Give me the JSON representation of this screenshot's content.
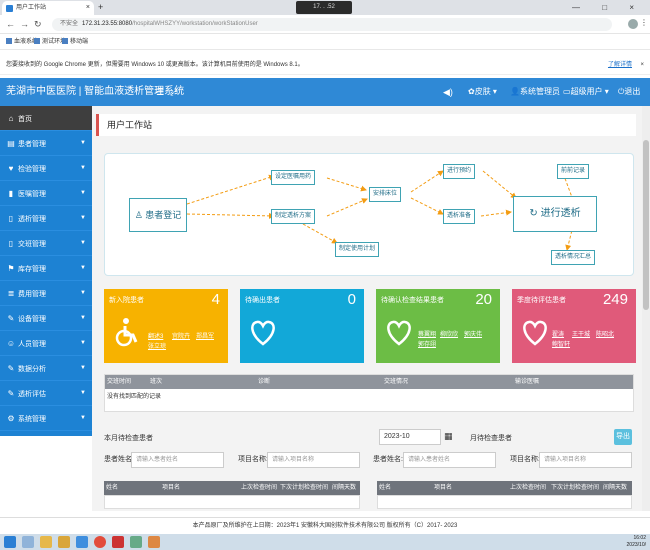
{
  "browser": {
    "tab_title": "用户工作站",
    "tab_close": "×",
    "new_tab": "+",
    "remote_label": "17.  .  .52",
    "window_controls": "—  □  ×",
    "insecure_label": "不安全",
    "url_host": "172.31.23.55:8080",
    "url_path": "/hospitalWHSZYY/workstation/workStationUser",
    "bookmarks": [
      "血液系统",
      "测试环境",
      "移动端"
    ],
    "info_message": "您要接收到的 Google Chrome 更新，但需要用 Windows 10 或更高版本。该计算机目前使用的是 Windows 8.1。",
    "info_more": "了解详情",
    "info_close": "×"
  },
  "header": {
    "system_name": "芜湖市中医医院 | 智能血液透析管理系统",
    "skin_label": "皮肤",
    "user_label": "系统管理员",
    "role_label": "超级用户",
    "logout_label": "退出"
  },
  "sidebar": {
    "items": [
      {
        "label": "首页",
        "icon": "home-icon"
      },
      {
        "label": "患者管理",
        "icon": "id-card-icon"
      },
      {
        "label": "检验管理",
        "icon": "heart-icon"
      },
      {
        "label": "医嘱管理",
        "icon": "bookmark-icon"
      },
      {
        "label": "透析管理",
        "icon": "document-icon"
      },
      {
        "label": "交班管理",
        "icon": "document-icon"
      },
      {
        "label": "库存管理",
        "icon": "flag-icon"
      },
      {
        "label": "费用管理",
        "icon": "database-icon"
      },
      {
        "label": "设备管理",
        "icon": "wrench-icon"
      },
      {
        "label": "人员管理",
        "icon": "users-icon"
      },
      {
        "label": "数据分析",
        "icon": "wrench-icon"
      },
      {
        "label": "透析评估",
        "icon": "wrench-icon"
      },
      {
        "label": "系统管理",
        "icon": "gear-icon"
      }
    ]
  },
  "page": {
    "title": "用户工作站"
  },
  "flow": {
    "patient_register": "患者登记",
    "set_orders": "设定医嘱用药",
    "make_plan": "制定透析方案",
    "make_usage": "制定使用计划",
    "schedule": "安排床位",
    "appointment": "进行预约",
    "prepare": "透析准备",
    "do_dialysis": "进行透析",
    "pre_record": "前前记录",
    "summary": "透析情况汇总"
  },
  "cards": [
    {
      "title": "新入院患者",
      "count": "4",
      "color": "#f7b200",
      "icon": "wheelchair-icon",
      "links": [
        "翻述3",
        "宫院卉",
        "郑昌军",
        "张立琼"
      ]
    },
    {
      "title": "待确出患者",
      "count": "0",
      "color": "#12a8d8",
      "icon": "heart-outline-icon",
      "links": []
    },
    {
      "title": "待确认检查结果患者",
      "count": "20",
      "color": "#6cbd45",
      "icon": "heart-outline-icon",
      "links": [
        "蔡翼翔",
        "柳欣欣",
        "郭庆伟",
        "郭存翊"
      ]
    },
    {
      "title": "季度待评估患者",
      "count": "249",
      "color": "#e05a7a",
      "icon": "heart-outline-icon",
      "links": [
        "翟涛",
        "王干城",
        "陈昭北",
        "鲍智轩"
      ]
    }
  ],
  "table": {
    "headers": [
      "交班时间",
      "班次",
      "诊断",
      "交班情况",
      "输诊医嘱"
    ],
    "empty_text": "没有找到匹配的记录"
  },
  "monthly": {
    "left_title": "本月待检查患者",
    "month_value": "2023-10",
    "right_title": "月待检查患者",
    "export_label": "导出",
    "patient_label": "患者姓名:",
    "patient_placeholder": "请输入患者姓名",
    "item_label": "项目名称:",
    "item_placeholder": "请输入项目名称",
    "left_headers": [
      "姓名",
      "项目名",
      "上次检查时间",
      "下次计划检查时间",
      "间隔天数"
    ],
    "right_headers": [
      "姓名",
      "项目名",
      "上次检查时间",
      "下次计划检查时间",
      "间隔天数"
    ]
  },
  "footer": {
    "text": "本产品原厂及所维护在上日期：2023年1 安徽科大国创软件技术有限公司 版权所有（C）2017- 2023"
  },
  "taskbar": {
    "time": "16:02",
    "date": "2023/10/"
  }
}
